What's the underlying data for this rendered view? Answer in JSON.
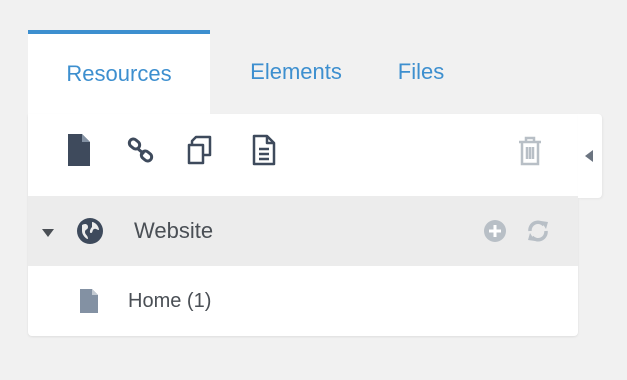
{
  "tabs": [
    {
      "label": "Resources",
      "active": true
    },
    {
      "label": "Elements",
      "active": false
    },
    {
      "label": "Files",
      "active": false
    }
  ],
  "toolbar": {
    "icons": [
      "new-document-icon",
      "link-icon",
      "duplicate-icon",
      "file-text-icon",
      "trash-icon"
    ]
  },
  "tree": {
    "root": {
      "label": "Website",
      "icon": "globe-icon",
      "expanded": true
    },
    "children": [
      {
        "label": "Home (1)",
        "icon": "document-icon"
      }
    ]
  },
  "colors": {
    "accent": "#3d8fcf",
    "icon_dark": "#3e4a5c",
    "icon_muted": "#b8bfc6",
    "row_highlight": "#ececec"
  }
}
